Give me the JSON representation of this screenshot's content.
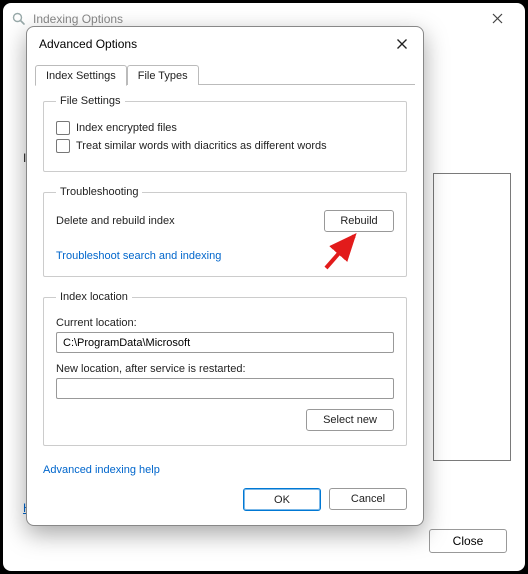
{
  "outer": {
    "title": "Indexing Options",
    "left_label": "I",
    "help_letter": "H",
    "close_label": "Close"
  },
  "inner": {
    "title": "Advanced Options",
    "tabs": {
      "settings": "Index Settings",
      "filetypes": "File Types"
    },
    "file_settings": {
      "legend": "File Settings",
      "encrypted": "Index encrypted files",
      "diacritics": "Treat similar words with diacritics as different words"
    },
    "troubleshooting": {
      "legend": "Troubleshooting",
      "rebuild_label": "Delete and rebuild index",
      "rebuild_button": "Rebuild",
      "troubleshoot_link": "Troubleshoot search and indexing"
    },
    "index_location": {
      "legend": "Index location",
      "current_label": "Current location:",
      "current_value": "C:\\ProgramData\\Microsoft",
      "new_label": "New location, after service is restarted:",
      "new_value": "",
      "select_new": "Select new"
    },
    "help_link": "Advanced indexing help",
    "ok": "OK",
    "cancel": "Cancel"
  }
}
